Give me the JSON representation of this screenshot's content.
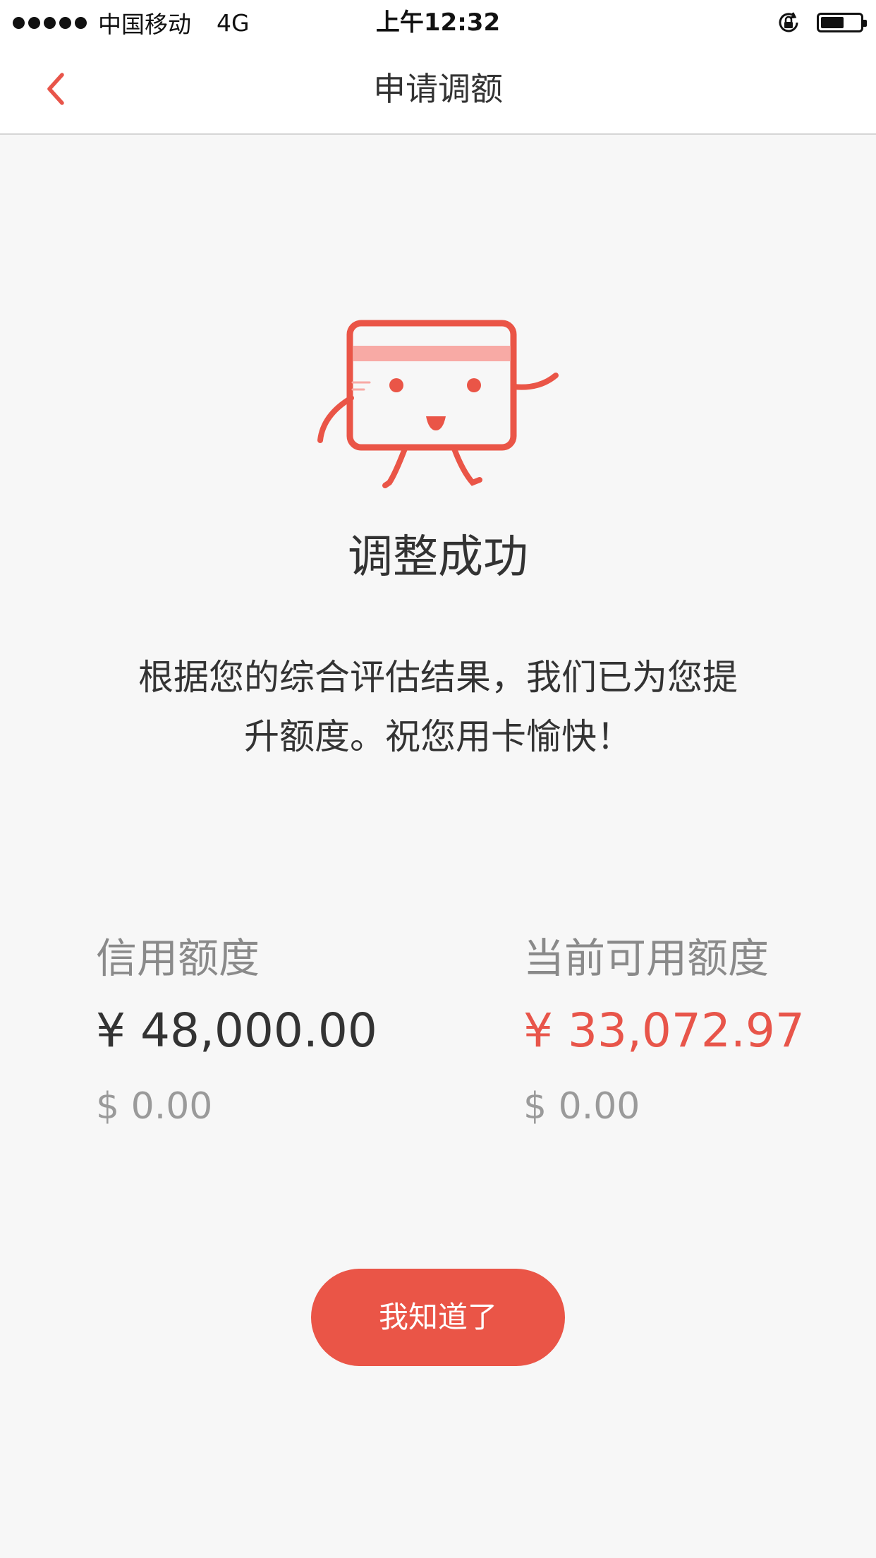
{
  "status_bar": {
    "carrier": "中国移动",
    "network": "4G",
    "time": "上午12:32",
    "battery_level": 0.6
  },
  "nav": {
    "title": "申请调额",
    "back_icon": "chevron-left-icon"
  },
  "result": {
    "illustration": "credit-card-mascot",
    "title": "调整成功",
    "message_line1": "根据您的综合评估结果，我们已为您提",
    "message_line2": "升额度。祝您用卡愉快！"
  },
  "limits": {
    "credit": {
      "label": "信用额度",
      "cny": "¥ 48,000.00",
      "usd": "$ 0.00"
    },
    "available": {
      "label": "当前可用额度",
      "cny": "¥ 33,072.97",
      "usd": "$ 0.00"
    }
  },
  "actions": {
    "confirm_label": "我知道了"
  },
  "colors": {
    "accent": "#ea5547",
    "accent_light": "#f8aaa5",
    "background": "#f7f7f7",
    "text_primary": "#333333",
    "text_secondary": "#8a8a8a"
  }
}
